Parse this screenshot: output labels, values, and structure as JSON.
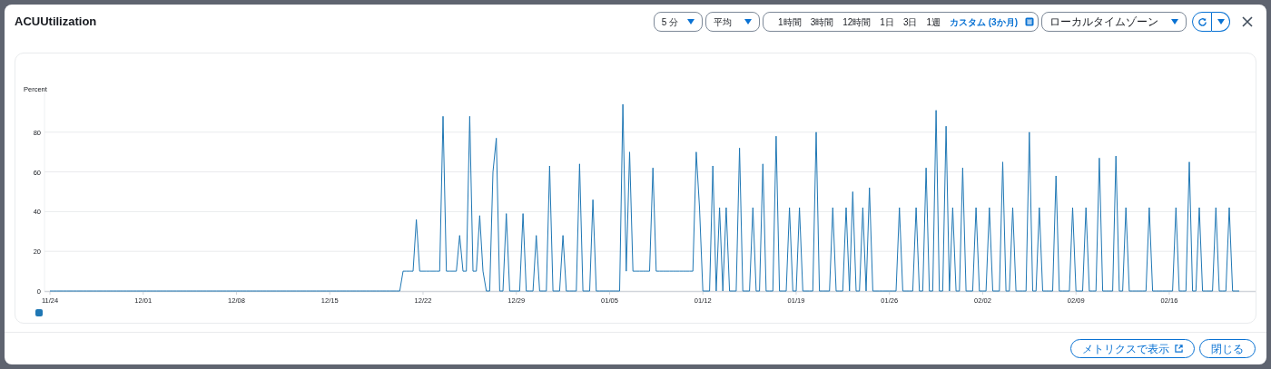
{
  "window": {
    "title": "ACUUtilization"
  },
  "toolbar": {
    "period": "5 分",
    "statistic": "平均",
    "ranges": [
      {
        "label": "1時間",
        "selected": false
      },
      {
        "label": "3時間",
        "selected": false
      },
      {
        "label": "12時間",
        "selected": false
      },
      {
        "label": "1日",
        "selected": false
      },
      {
        "label": "3日",
        "selected": false
      },
      {
        "label": "1週",
        "selected": false
      },
      {
        "label": "カスタム (3か月)",
        "selected": true
      }
    ],
    "timezone": "ローカルタイムゾーン"
  },
  "chart": {
    "chart_data": {
      "type": "line",
      "annotations": [
        {
          "text": "Percent"
        }
      ],
      "ylim": [
        0,
        100
      ],
      "grid": true,
      "yticks": [
        0,
        20,
        40,
        60,
        80
      ],
      "categories": [
        "11/24",
        null,
        null,
        null,
        null,
        null,
        null,
        null,
        null,
        null,
        null,
        null,
        null,
        null,
        null,
        null,
        null,
        null,
        null,
        null,
        null,
        null,
        null,
        null,
        null,
        null,
        null,
        null,
        "12/01",
        null,
        null,
        null,
        null,
        null,
        null,
        null,
        null,
        null,
        null,
        null,
        null,
        null,
        null,
        null,
        null,
        null,
        null,
        null,
        null,
        null,
        null,
        null,
        null,
        null,
        null,
        null,
        "12/08",
        null,
        null,
        null,
        null,
        null,
        null,
        null,
        null,
        null,
        null,
        null,
        null,
        null,
        null,
        null,
        null,
        null,
        null,
        null,
        null,
        null,
        null,
        null,
        null,
        null,
        null,
        null,
        "12/15",
        null,
        null,
        null,
        null,
        null,
        null,
        null,
        null,
        null,
        null,
        null,
        null,
        null,
        null,
        null,
        null,
        null,
        null,
        null,
        null,
        null,
        null,
        null,
        null,
        null,
        null,
        null,
        "12/22",
        null,
        null,
        null,
        null,
        null,
        null,
        null,
        null,
        null,
        null,
        null,
        null,
        null,
        null,
        null,
        null,
        null,
        null,
        null,
        null,
        null,
        null,
        null,
        null,
        null,
        null,
        null,
        "12/29",
        null,
        null,
        null,
        null,
        null,
        null,
        null,
        null,
        null,
        null,
        null,
        null,
        null,
        null,
        null,
        null,
        null,
        null,
        null,
        null,
        null,
        null,
        null,
        null,
        null,
        null,
        null,
        "01/05",
        null,
        null,
        null,
        null,
        null,
        null,
        null,
        null,
        null,
        null,
        null,
        null,
        null,
        null,
        null,
        null,
        null,
        null,
        null,
        null,
        null,
        null,
        null,
        null,
        null,
        null,
        null,
        "01/12",
        null,
        null,
        null,
        null,
        null,
        null,
        null,
        null,
        null,
        null,
        null,
        null,
        null,
        null,
        null,
        null,
        null,
        null,
        null,
        null,
        null,
        null,
        null,
        null,
        null,
        null,
        null,
        "01/19",
        null,
        null,
        null,
        null,
        null,
        null,
        null,
        null,
        null,
        null,
        null,
        null,
        null,
        null,
        null,
        null,
        null,
        null,
        null,
        null,
        null,
        null,
        null,
        null,
        null,
        null,
        null,
        "01/26",
        null,
        null,
        null,
        null,
        null,
        null,
        null,
        null,
        null,
        null,
        null,
        null,
        null,
        null,
        null,
        null,
        null,
        null,
        null,
        null,
        null,
        null,
        null,
        null,
        null,
        null,
        null,
        "02/02",
        null,
        null,
        null,
        null,
        null,
        null,
        null,
        null,
        null,
        null,
        null,
        null,
        null,
        null,
        null,
        null,
        null,
        null,
        null,
        null,
        null,
        null,
        null,
        null,
        null,
        null,
        null,
        "02/09",
        null,
        null,
        null,
        null,
        null,
        null,
        null,
        null,
        null,
        null,
        null,
        null,
        null,
        null,
        null,
        null,
        null,
        null,
        null,
        null,
        null,
        null,
        null,
        null,
        null,
        null,
        null,
        "02/16",
        null,
        null,
        null,
        null,
        null,
        null,
        null,
        null,
        null,
        null,
        null,
        null,
        null,
        null,
        null,
        null,
        null,
        null,
        null,
        null,
        null
      ],
      "series": [
        {
          "color": "#1f77b4",
          "values": [
            0,
            0,
            0,
            0,
            0,
            0,
            0,
            0,
            0,
            0,
            0,
            0,
            0,
            0,
            0,
            0,
            0,
            0,
            0,
            0,
            0,
            0,
            0,
            0,
            0,
            0,
            0,
            0,
            0,
            0,
            0,
            0,
            0,
            0,
            0,
            0,
            0,
            0,
            0,
            0,
            0,
            0,
            0,
            0,
            0,
            0,
            0,
            0,
            0,
            0,
            0,
            0,
            0,
            0,
            0,
            0,
            0,
            0,
            0,
            0,
            0,
            0,
            0,
            0,
            0,
            0,
            0,
            0,
            0,
            0,
            0,
            0,
            0,
            0,
            0,
            0,
            0,
            0,
            0,
            0,
            0,
            0,
            0,
            0,
            0,
            0,
            0,
            0,
            0,
            0,
            0,
            0,
            0,
            0,
            0,
            0,
            0,
            0,
            0,
            0,
            0,
            0,
            0,
            0,
            0,
            0,
            10,
            10,
            10,
            10,
            36,
            10,
            10,
            10,
            10,
            10,
            10,
            10,
            88,
            10,
            10,
            10,
            10,
            28,
            10,
            10,
            88,
            10,
            10,
            38,
            10,
            0,
            0,
            60,
            77,
            0,
            0,
            39,
            0,
            0,
            0,
            0,
            39,
            0,
            0,
            0,
            28,
            0,
            0,
            0,
            63,
            0,
            0,
            0,
            28,
            0,
            0,
            0,
            0,
            64,
            0,
            0,
            0,
            46,
            0,
            0,
            0,
            0,
            0,
            0,
            0,
            0,
            94,
            10,
            70,
            10,
            10,
            10,
            10,
            10,
            10,
            62,
            10,
            10,
            10,
            10,
            10,
            10,
            10,
            10,
            10,
            10,
            10,
            10,
            70,
            42,
            0,
            0,
            0,
            63,
            0,
            42,
            0,
            42,
            0,
            0,
            0,
            72,
            0,
            0,
            0,
            42,
            0,
            0,
            64,
            0,
            0,
            0,
            78,
            0,
            0,
            0,
            42,
            0,
            0,
            42,
            0,
            0,
            0,
            0,
            80,
            0,
            0,
            0,
            0,
            42,
            0,
            0,
            0,
            42,
            0,
            50,
            0,
            0,
            42,
            0,
            52,
            0,
            0,
            0,
            0,
            0,
            0,
            0,
            0,
            42,
            0,
            0,
            0,
            0,
            42,
            0,
            0,
            62,
            0,
            0,
            91,
            0,
            0,
            83,
            0,
            42,
            0,
            0,
            62,
            0,
            0,
            0,
            42,
            0,
            0,
            0,
            42,
            0,
            0,
            0,
            65,
            0,
            0,
            42,
            0,
            0,
            0,
            0,
            80,
            0,
            0,
            42,
            0,
            0,
            0,
            0,
            58,
            0,
            0,
            0,
            0,
            42,
            0,
            0,
            0,
            42,
            0,
            0,
            0,
            67,
            0,
            0,
            0,
            0,
            68,
            0,
            0,
            42,
            0,
            0,
            0,
            0,
            0,
            0,
            42,
            0,
            0,
            0,
            0,
            0,
            0,
            0,
            42,
            0,
            0,
            0,
            65,
            0,
            0,
            42,
            0,
            0,
            0,
            0,
            42,
            0,
            0,
            0,
            42,
            0,
            0,
            0
          ]
        }
      ]
    }
  },
  "buttons": {
    "view_in_metrics": "メトリクスで表示",
    "close": "閉じる"
  }
}
